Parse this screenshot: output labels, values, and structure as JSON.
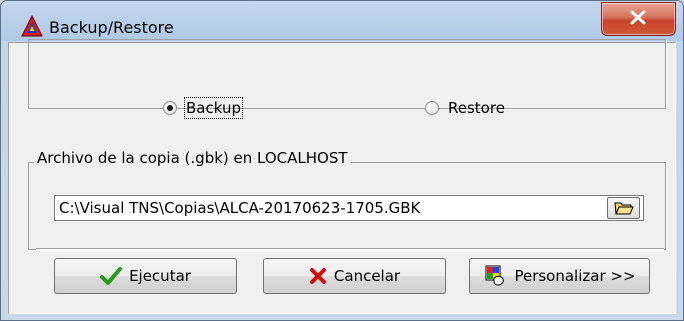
{
  "window": {
    "title": "Backup/Restore"
  },
  "mode": {
    "options": [
      {
        "label": "Backup",
        "selected": true
      },
      {
        "label": "Restore",
        "selected": false
      }
    ]
  },
  "file_group": {
    "caption": "Archivo de la copia (.gbk) en LOCALHOST",
    "path": "C:\\Visual TNS\\Copias\\ALCA-20170623-1705.GBK"
  },
  "buttons": {
    "execute": "Ejecutar",
    "cancel": "Cancelar",
    "customize": "Personalizar >>"
  },
  "icons": {
    "app": "triangle-a-logo-icon",
    "close": "close-x-icon",
    "browse": "folder-open-icon",
    "execute": "green-check-icon",
    "cancel": "red-x-icon",
    "customize": "palette-icon"
  },
  "colors": {
    "close_button": "#c7432a",
    "check": "#2a9a1e",
    "cancel_x": "#d01010"
  }
}
